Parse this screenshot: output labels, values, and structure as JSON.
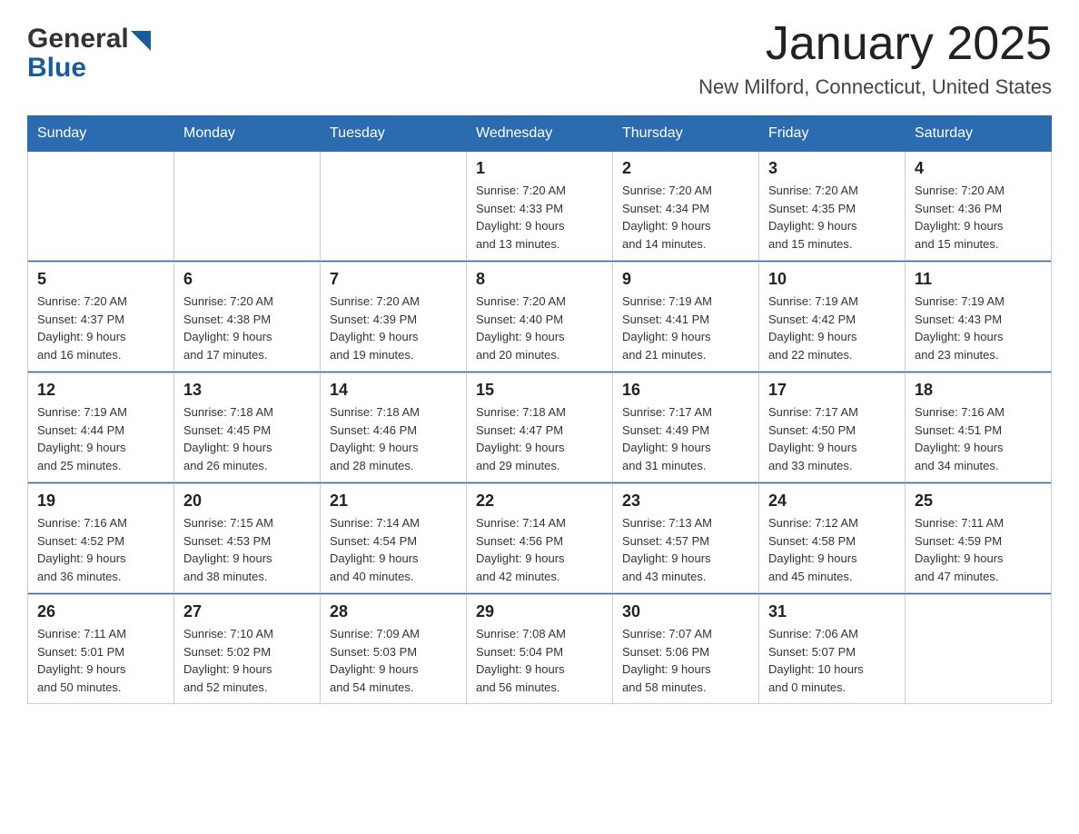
{
  "header": {
    "logo_text_general": "General",
    "logo_text_blue": "Blue",
    "title": "January 2025",
    "subtitle": "New Milford, Connecticut, United States"
  },
  "calendar": {
    "days_of_week": [
      "Sunday",
      "Monday",
      "Tuesday",
      "Wednesday",
      "Thursday",
      "Friday",
      "Saturday"
    ],
    "weeks": [
      [
        {
          "day": "",
          "info": ""
        },
        {
          "day": "",
          "info": ""
        },
        {
          "day": "",
          "info": ""
        },
        {
          "day": "1",
          "info": "Sunrise: 7:20 AM\nSunset: 4:33 PM\nDaylight: 9 hours\nand 13 minutes."
        },
        {
          "day": "2",
          "info": "Sunrise: 7:20 AM\nSunset: 4:34 PM\nDaylight: 9 hours\nand 14 minutes."
        },
        {
          "day": "3",
          "info": "Sunrise: 7:20 AM\nSunset: 4:35 PM\nDaylight: 9 hours\nand 15 minutes."
        },
        {
          "day": "4",
          "info": "Sunrise: 7:20 AM\nSunset: 4:36 PM\nDaylight: 9 hours\nand 15 minutes."
        }
      ],
      [
        {
          "day": "5",
          "info": "Sunrise: 7:20 AM\nSunset: 4:37 PM\nDaylight: 9 hours\nand 16 minutes."
        },
        {
          "day": "6",
          "info": "Sunrise: 7:20 AM\nSunset: 4:38 PM\nDaylight: 9 hours\nand 17 minutes."
        },
        {
          "day": "7",
          "info": "Sunrise: 7:20 AM\nSunset: 4:39 PM\nDaylight: 9 hours\nand 19 minutes."
        },
        {
          "day": "8",
          "info": "Sunrise: 7:20 AM\nSunset: 4:40 PM\nDaylight: 9 hours\nand 20 minutes."
        },
        {
          "day": "9",
          "info": "Sunrise: 7:19 AM\nSunset: 4:41 PM\nDaylight: 9 hours\nand 21 minutes."
        },
        {
          "day": "10",
          "info": "Sunrise: 7:19 AM\nSunset: 4:42 PM\nDaylight: 9 hours\nand 22 minutes."
        },
        {
          "day": "11",
          "info": "Sunrise: 7:19 AM\nSunset: 4:43 PM\nDaylight: 9 hours\nand 23 minutes."
        }
      ],
      [
        {
          "day": "12",
          "info": "Sunrise: 7:19 AM\nSunset: 4:44 PM\nDaylight: 9 hours\nand 25 minutes."
        },
        {
          "day": "13",
          "info": "Sunrise: 7:18 AM\nSunset: 4:45 PM\nDaylight: 9 hours\nand 26 minutes."
        },
        {
          "day": "14",
          "info": "Sunrise: 7:18 AM\nSunset: 4:46 PM\nDaylight: 9 hours\nand 28 minutes."
        },
        {
          "day": "15",
          "info": "Sunrise: 7:18 AM\nSunset: 4:47 PM\nDaylight: 9 hours\nand 29 minutes."
        },
        {
          "day": "16",
          "info": "Sunrise: 7:17 AM\nSunset: 4:49 PM\nDaylight: 9 hours\nand 31 minutes."
        },
        {
          "day": "17",
          "info": "Sunrise: 7:17 AM\nSunset: 4:50 PM\nDaylight: 9 hours\nand 33 minutes."
        },
        {
          "day": "18",
          "info": "Sunrise: 7:16 AM\nSunset: 4:51 PM\nDaylight: 9 hours\nand 34 minutes."
        }
      ],
      [
        {
          "day": "19",
          "info": "Sunrise: 7:16 AM\nSunset: 4:52 PM\nDaylight: 9 hours\nand 36 minutes."
        },
        {
          "day": "20",
          "info": "Sunrise: 7:15 AM\nSunset: 4:53 PM\nDaylight: 9 hours\nand 38 minutes."
        },
        {
          "day": "21",
          "info": "Sunrise: 7:14 AM\nSunset: 4:54 PM\nDaylight: 9 hours\nand 40 minutes."
        },
        {
          "day": "22",
          "info": "Sunrise: 7:14 AM\nSunset: 4:56 PM\nDaylight: 9 hours\nand 42 minutes."
        },
        {
          "day": "23",
          "info": "Sunrise: 7:13 AM\nSunset: 4:57 PM\nDaylight: 9 hours\nand 43 minutes."
        },
        {
          "day": "24",
          "info": "Sunrise: 7:12 AM\nSunset: 4:58 PM\nDaylight: 9 hours\nand 45 minutes."
        },
        {
          "day": "25",
          "info": "Sunrise: 7:11 AM\nSunset: 4:59 PM\nDaylight: 9 hours\nand 47 minutes."
        }
      ],
      [
        {
          "day": "26",
          "info": "Sunrise: 7:11 AM\nSunset: 5:01 PM\nDaylight: 9 hours\nand 50 minutes."
        },
        {
          "day": "27",
          "info": "Sunrise: 7:10 AM\nSunset: 5:02 PM\nDaylight: 9 hours\nand 52 minutes."
        },
        {
          "day": "28",
          "info": "Sunrise: 7:09 AM\nSunset: 5:03 PM\nDaylight: 9 hours\nand 54 minutes."
        },
        {
          "day": "29",
          "info": "Sunrise: 7:08 AM\nSunset: 5:04 PM\nDaylight: 9 hours\nand 56 minutes."
        },
        {
          "day": "30",
          "info": "Sunrise: 7:07 AM\nSunset: 5:06 PM\nDaylight: 9 hours\nand 58 minutes."
        },
        {
          "day": "31",
          "info": "Sunrise: 7:06 AM\nSunset: 5:07 PM\nDaylight: 10 hours\nand 0 minutes."
        },
        {
          "day": "",
          "info": ""
        }
      ]
    ]
  }
}
